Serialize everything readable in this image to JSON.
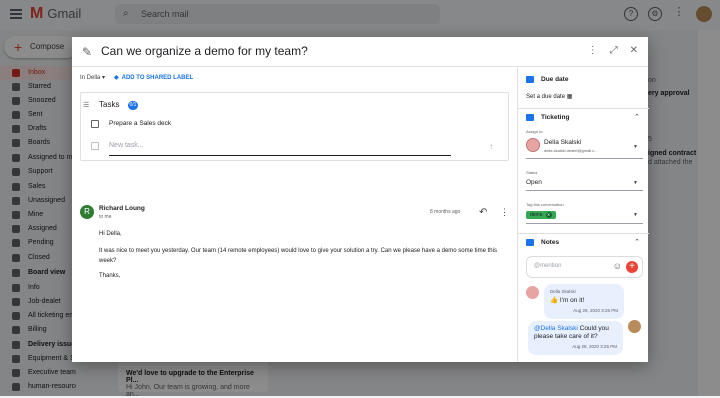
{
  "app": {
    "logo": "Gmail",
    "search_placeholder": "Search mail"
  },
  "sidebar": {
    "compose_label": "Compose",
    "items": [
      {
        "label": "Inbox"
      },
      {
        "label": "Starred"
      },
      {
        "label": "Snoozed"
      },
      {
        "label": "Sent"
      },
      {
        "label": "Drafts"
      },
      {
        "label": "Boards"
      },
      {
        "label": "Assigned to me"
      },
      {
        "label": "Support"
      },
      {
        "label": "Sales"
      },
      {
        "label": "Unassigned"
      },
      {
        "label": "Mine"
      },
      {
        "label": "Assigned"
      },
      {
        "label": "Pending"
      },
      {
        "label": "Closed"
      },
      {
        "label": "Board view"
      },
      {
        "label": "Info"
      },
      {
        "label": "Job-dealet"
      },
      {
        "label": "All ticketing em"
      },
      {
        "label": "Billing"
      },
      {
        "label": "Delivery issues"
      },
      {
        "label": "Equipment & S"
      },
      {
        "label": "Executive team"
      },
      {
        "label": "human-resources"
      }
    ]
  },
  "background": {
    "right_snippets": [
      "on",
      "ery approval",
      "igned contract",
      "d attached the",
      "5"
    ],
    "card_title": "We'd love to upgrade to the Enterprise Pl...",
    "card_snippet": "Hi John, Our team is growing, and more an..."
  },
  "modal": {
    "title": "Can we organize a demo for my team?",
    "in_label": "In Della",
    "shared_label": "ADD TO SHARED LABEL",
    "tasks": {
      "title": "Tasks",
      "count": "0/1",
      "items": [
        {
          "label": "Prepare a Sales deck"
        }
      ],
      "new_placeholder": "New task..."
    },
    "message": {
      "avatar_letter": "R",
      "from": "Richard Loung",
      "to": "to me",
      "when": "8 months ago",
      "greeting": "Hi Della,",
      "body": "It was nice to meet you yesterday. Our team (14 remote employees) would love to give your solution a try. Can we please have a demo some time this week?",
      "closing": "Thanks,"
    },
    "side": {
      "due_date": {
        "title": "Due date",
        "value": "Set a due date"
      },
      "ticketing": {
        "title": "Ticketing",
        "assign_label": "Assign to",
        "assignee_name": "Della Skalski",
        "assignee_email": "della.skalski.dealet@gmail.c...",
        "status_label": "Status",
        "status_value": "Open",
        "tag_label": "Tag this conversation",
        "tag_value": "demo"
      },
      "notes": {
        "title": "Notes",
        "placeholder": "@mention",
        "entries": [
          {
            "author": "Della Skalski",
            "text": "👍 I'm on it!",
            "time": "Aug 28, 2020 3:26 PM"
          },
          {
            "mention": "@Della Skalski",
            "text": " Could you please take care of it?",
            "time": "Aug 28, 2020 3:26 PM"
          }
        ]
      }
    }
  },
  "colors": {
    "accent": "#1a73e8",
    "tag": "#34a853",
    "brand": "#ea4335"
  }
}
